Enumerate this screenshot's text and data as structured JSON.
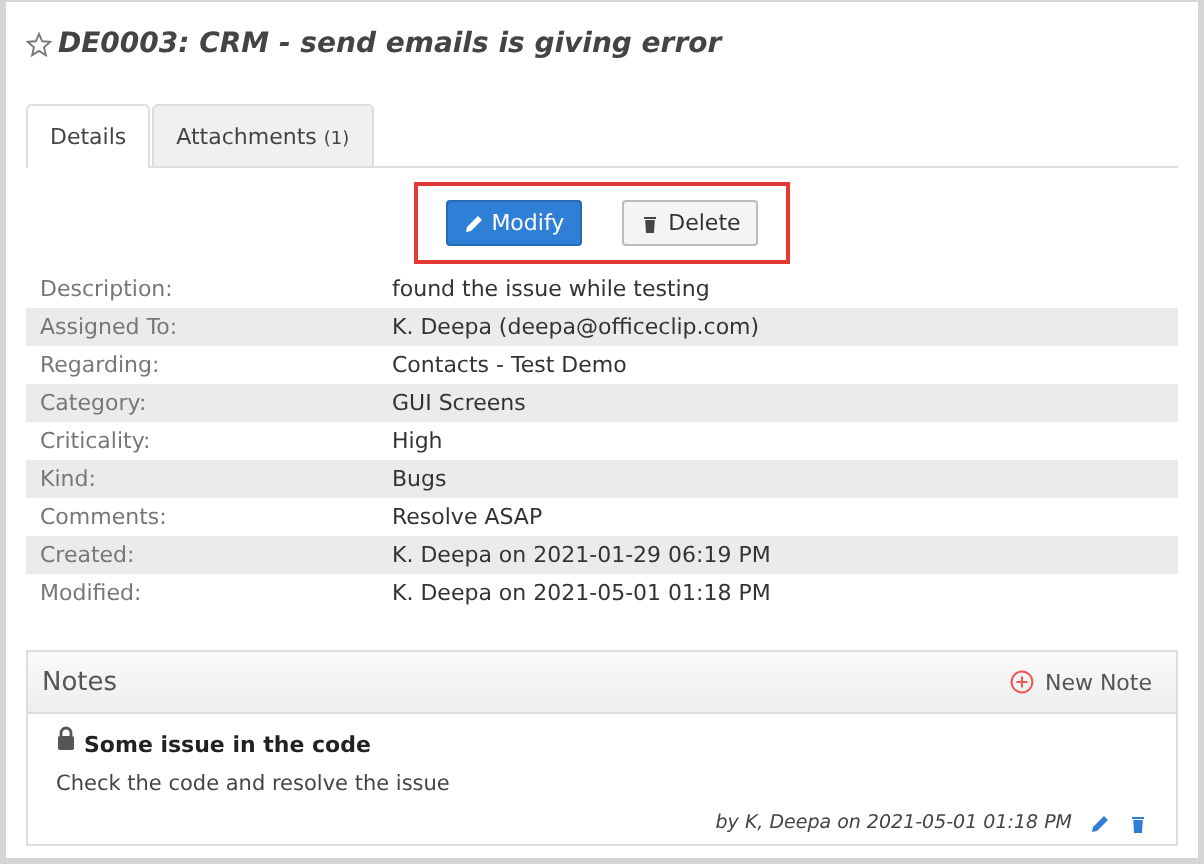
{
  "title": "DE0003: CRM - send emails is giving error",
  "tabs": [
    {
      "label": "Details",
      "selected": true
    },
    {
      "label": "Attachments",
      "count": "(1)",
      "selected": false
    }
  ],
  "actions": {
    "highlighted": true,
    "buttons": [
      {
        "label": "Modify",
        "kind": "primary"
      },
      {
        "label": "Delete",
        "kind": "secondary"
      }
    ]
  },
  "fields": [
    {
      "label": "Description:",
      "value": "found the issue while testing"
    },
    {
      "label": "Assigned To:",
      "value": "K. Deepa (deepa@officeclip.com)"
    },
    {
      "label": "Regarding:",
      "value": "Contacts - Test Demo"
    },
    {
      "label": "Category:",
      "value": "GUI Screens"
    },
    {
      "label": "Criticality:",
      "value": "High"
    },
    {
      "label": "Kind:",
      "value": "Bugs"
    },
    {
      "label": "Comments:",
      "value": "Resolve ASAP"
    },
    {
      "label": "Created:",
      "value": "K. Deepa on 2021-01-29 06:19 PM"
    },
    {
      "label": "Modified:",
      "value": "K. Deepa on 2021-05-01 01:18 PM"
    }
  ],
  "notes": {
    "title": "Notes",
    "new_label": "New Note",
    "items": [
      {
        "title": "Some issue in the code",
        "locked": true,
        "body": "Check the code and resolve the issue",
        "byline": "by  K, Deepa on  2021-05-01 01:18 PM"
      }
    ]
  }
}
